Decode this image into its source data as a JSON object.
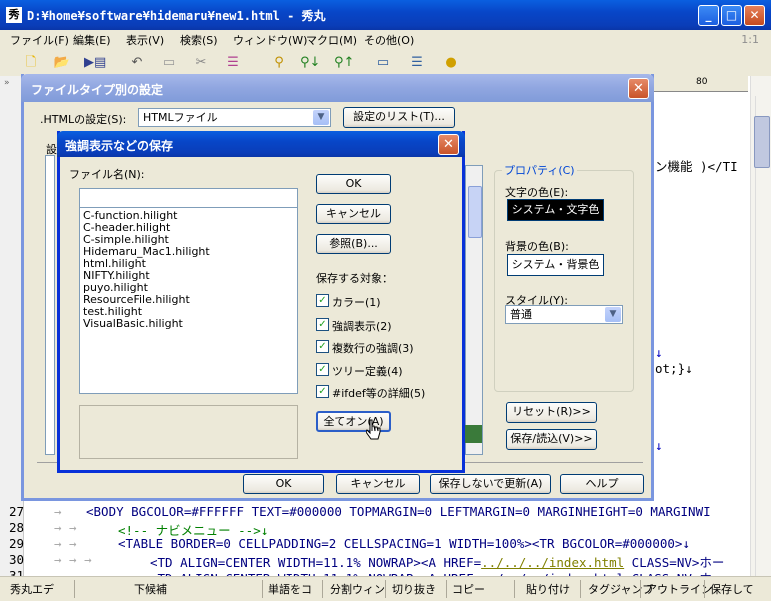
{
  "window": {
    "title": "D:¥home¥software¥hidemaru¥new1.html - 秀丸",
    "icon": "秀"
  },
  "menu": {
    "items": [
      "ファイル(F)",
      "編集(E)",
      "表示(V)",
      "検索(S)",
      "ウィンドウ(W)",
      "マクロ(M)",
      "その他(O)"
    ],
    "position": "1:1"
  },
  "toolbar": {
    "icons": [
      "new-file-icon",
      "open-folder-icon",
      "save-icon",
      "undo-icon",
      "copy-icon",
      "cut-icon",
      "paste-icon",
      "search-icon",
      "search-down-icon",
      "search-up-icon",
      "grep-icon",
      "split-window-icon",
      "help-icon"
    ]
  },
  "editor": {
    "ruler_mark": "80",
    "partial_right": [
      "ン機能 )</TI",
      "↓",
      "ot;}↓",
      "↓"
    ],
    "lines": [
      {
        "num": "27",
        "text": "<BODY BGCOLOR=#FFFFFF TEXT=#000000 TOPMARGIN=0 LEFTMARGIN=0 MARGINHEIGHT=0 MARGINWI"
      },
      {
        "num": "28",
        "text": "<!-- ナビメニュー -->↓"
      },
      {
        "num": "29",
        "text": "<TABLE BORDER=0 CELLPADDING=2 CELLSPACING=1 WIDTH=100%><TR BGCOLOR=#000000>↓"
      },
      {
        "num": "30",
        "text_a": "<TD ALIGN=CENTER WIDTH=11.1% NOWRAP><A HREF=",
        "text_link": "../../../index.html",
        "text_b": " CLASS=NV>ホー"
      },
      {
        "num": "31",
        "text": "<TD ALIGN=CENTER WIDTH=11.1% NOWRAP><A HREF=../../../index.html CLASS=NV>ホー"
      }
    ]
  },
  "status": [
    "秀丸エデ",
    "下候補",
    "単語をコ",
    "分割ウィン",
    "切り抜き",
    "コピー",
    "貼り付け",
    "タグジャンプ",
    "アウトライン",
    "保存して"
  ],
  "filetype_dialog": {
    "title": "ファイルタイプ別の設定",
    "html_setting_label": ".HTMLの設定(S):",
    "html_setting_value": "HTMLファイル",
    "list_button": "設定のリスト(T)...",
    "settings_label_partial": "設",
    "property_group": "プロパティ(C)",
    "fg_label": "文字の色(E):",
    "fg_value": "システム・文字色",
    "bg_label": "背景の色(B):",
    "bg_value": "システム・背景色",
    "style_label": "スタイル(Y):",
    "style_value": "普通",
    "reset_button": "リセット(R)>>",
    "saveload_button": "保存/読込(V)>>",
    "ok": "OK",
    "cancel": "キャンセル",
    "update_nosave": "保存しないで更新(A)",
    "help": "ヘルプ"
  },
  "save_dialog": {
    "title": "強調表示などの保存",
    "filename_label": "ファイル名(N):",
    "filename_value": "",
    "files": [
      "C-function.hilight",
      "C-header.hilight",
      "C-simple.hilight",
      "Hidemaru_Mac1.hilight",
      "html.hilight",
      "NIFTY.hilight",
      "puyo.hilight",
      "ResourceFile.hilight",
      "test.hilight",
      "VisualBasic.hilight"
    ],
    "ok": "OK",
    "cancel": "キャンセル",
    "browse": "参照(B)...",
    "targets_label": "保存する対象：",
    "checks": [
      "カラー(1)",
      "強調表示(2)",
      "複数行の強調(3)",
      "ツリー定義(4)",
      "#ifdef等の詳細(5)"
    ],
    "all_on": "全てオン(A)"
  }
}
